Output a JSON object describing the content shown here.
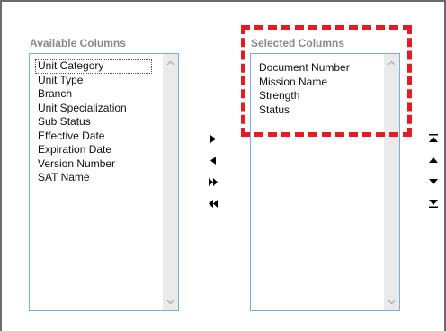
{
  "available": {
    "heading": "Available Columns",
    "items": [
      "Unit Category",
      "Unit Type",
      "Branch",
      "Unit Specialization",
      "Sub Status",
      "Effective Date",
      "Expiration Date",
      "Version Number",
      "SAT Name"
    ]
  },
  "selected": {
    "heading": "Selected Columns",
    "items": [
      "Document Number",
      "Mission Name",
      "Strength",
      "Status"
    ]
  },
  "transfer_buttons": [
    "move-right",
    "move-left",
    "move-all-right",
    "move-all-left"
  ],
  "order_buttons": [
    "move-top",
    "move-up",
    "move-down",
    "move-bottom"
  ],
  "colors": {
    "highlight": "#e31b23",
    "list_border": "#7ab0d8",
    "heading": "#8a8a8a",
    "scrollbar": "#eaeaea"
  }
}
